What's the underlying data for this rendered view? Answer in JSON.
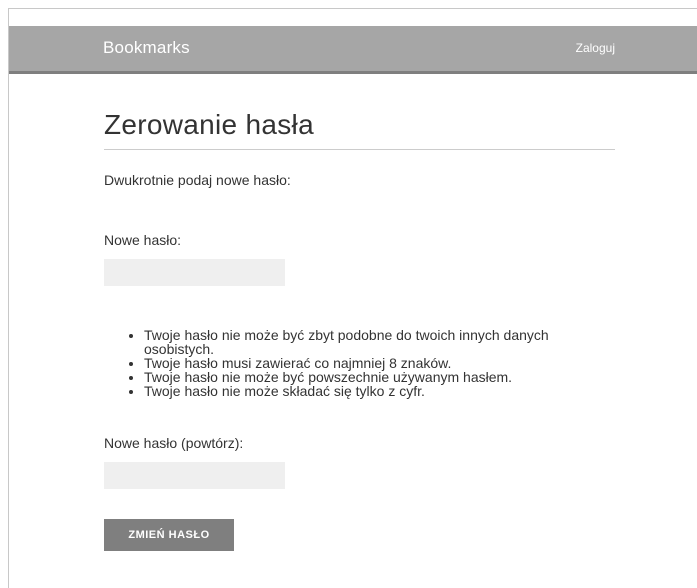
{
  "header": {
    "brand": "Bookmarks",
    "login_label": "Zaloguj"
  },
  "main": {
    "title": "Zerowanie hasła",
    "intro": "Dwukrotnie podaj nowe hasło:",
    "new_password": {
      "label": "Nowe hasło:",
      "value": "",
      "placeholder": ""
    },
    "rules": [
      "Twoje hasło nie może być zbyt podobne do twoich innych danych osobistych.",
      "Twoje hasło musi zawierać co najmniej 8 znaków.",
      "Twoje hasło nie może być powszechnie używanym hasłem.",
      "Twoje hasło nie może składać się tylko z cyfr."
    ],
    "repeat_password": {
      "label": "Nowe hasło (powtórz):",
      "value": "",
      "placeholder": ""
    },
    "submit_label": "ZMIEŃ HASŁO"
  },
  "colors": {
    "header_bg": "#a6a6a6",
    "header_border": "#7f7f7f",
    "button_bg": "#7f7f7f",
    "input_bg": "#efefef"
  }
}
